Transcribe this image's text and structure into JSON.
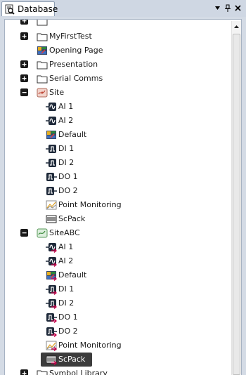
{
  "window": {
    "title": "Database",
    "buttons": {
      "dropdown": "▼",
      "pin": "📌",
      "close": "✕"
    }
  },
  "tree": {
    "items": [
      {
        "label": "MyFirstTest",
        "icon": "folder-icon",
        "level": 0,
        "expander": "plus"
      },
      {
        "label": "Opening Page",
        "icon": "page-icon",
        "level": 0,
        "expander": "none"
      },
      {
        "label": "Presentation",
        "icon": "folder-icon",
        "level": 0,
        "expander": "plus"
      },
      {
        "label": "Serial Comms",
        "icon": "folder-icon",
        "level": 0,
        "expander": "plus"
      },
      {
        "label": "Site",
        "icon": "site-icon",
        "level": 0,
        "expander": "minus"
      },
      {
        "label": "AI 1",
        "icon": "analog-input-icon",
        "level": 1
      },
      {
        "label": "AI 2",
        "icon": "analog-input-icon",
        "level": 1
      },
      {
        "label": "Default",
        "icon": "page-icon",
        "level": 1
      },
      {
        "label": "DI 1",
        "icon": "digital-input-icon",
        "level": 1
      },
      {
        "label": "DI 2",
        "icon": "digital-input-icon",
        "level": 1
      },
      {
        "label": "DO 1",
        "icon": "digital-output-icon",
        "level": 1
      },
      {
        "label": "DO 2",
        "icon": "digital-output-icon",
        "level": 1
      },
      {
        "label": "Point Monitoring",
        "icon": "trend-icon",
        "level": 1
      },
      {
        "label": "ScPack",
        "icon": "scpack-icon",
        "level": 1
      },
      {
        "label": "SiteABC",
        "icon": "site-abc-icon",
        "level": 0,
        "expander": "minus"
      },
      {
        "label": "AI 1",
        "icon": "analog-input-icon",
        "level": 1,
        "linked": true
      },
      {
        "label": "AI 2",
        "icon": "analog-input-icon",
        "level": 1,
        "linked": true
      },
      {
        "label": "Default",
        "icon": "page-icon",
        "level": 1,
        "linked": true
      },
      {
        "label": "DI 1",
        "icon": "digital-input-icon",
        "level": 1,
        "linked": true
      },
      {
        "label": "DI 2",
        "icon": "digital-input-icon",
        "level": 1,
        "linked": true
      },
      {
        "label": "DO 1",
        "icon": "digital-output-icon",
        "level": 1,
        "linked": true
      },
      {
        "label": "DO 2",
        "icon": "digital-output-icon",
        "level": 1,
        "linked": true
      },
      {
        "label": "Point Monitoring",
        "icon": "trend-icon",
        "level": 1,
        "linked": true
      },
      {
        "label": "ScPack",
        "icon": "scpack-icon",
        "level": 1,
        "linked": true,
        "selected": true
      },
      {
        "label": "Symbol Library",
        "icon": "folder-icon",
        "level": 0,
        "expander": "plus"
      }
    ]
  },
  "colors": {
    "selection": "#3c3c3c",
    "link_arrow": "#c8004b"
  }
}
